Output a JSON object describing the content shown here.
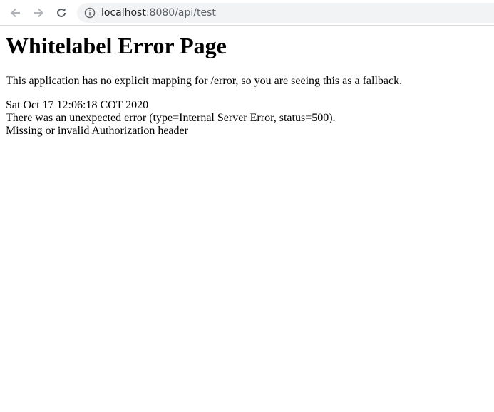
{
  "browser": {
    "url_host": "localhost",
    "url_rest": ":8080/api/test",
    "icons": {
      "back": "arrow-left-icon",
      "forward": "arrow-right-icon",
      "reload": "reload-icon",
      "info": "info-icon"
    }
  },
  "page": {
    "heading": "Whitelabel Error Page",
    "message": "This application has no explicit mapping for /error, so you are seeing this as a fallback.",
    "timestamp": "Sat Oct 17 12:06:18 COT 2020",
    "error_line": "There was an unexpected error (type=Internal Server Error, status=500).",
    "error_detail": "Missing or invalid Authorization header"
  }
}
